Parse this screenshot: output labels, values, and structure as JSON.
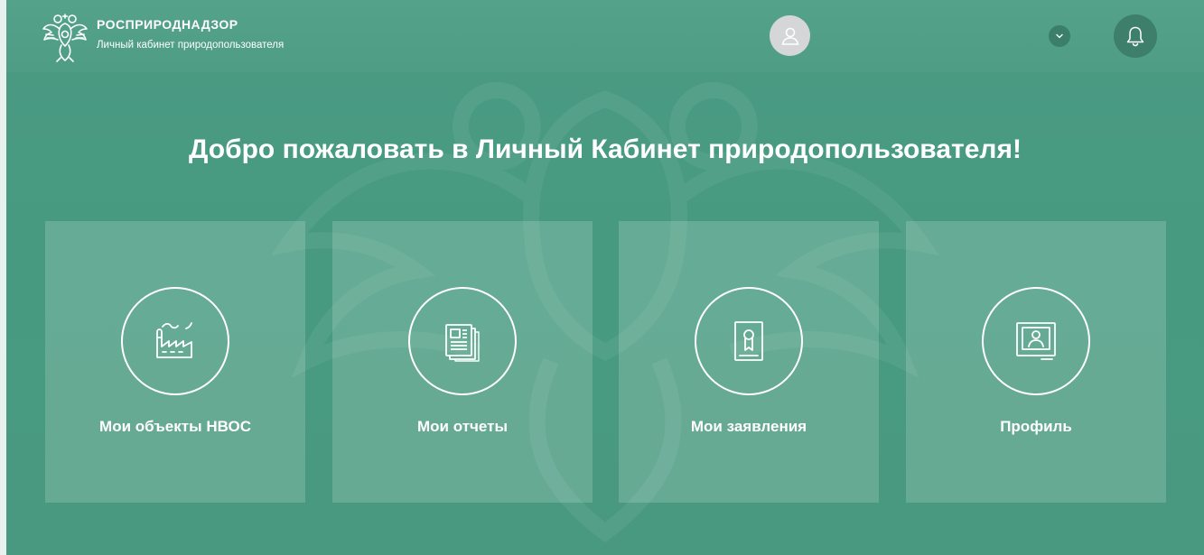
{
  "header": {
    "brand_title": "РОСПРИРОДНАДЗОР",
    "brand_subtitle": "Личный кабинет природопользователя",
    "logo_icon": "double-headed-eagle-emblem",
    "avatar_icon": "user-icon",
    "dropdown_icon": "chevron-down-icon",
    "notifications_icon": "bell-icon"
  },
  "main": {
    "welcome_title": "Добро пожаловать в Личный Кабинет природопользователя!",
    "cards": [
      {
        "label": "Мои объекты НВОС",
        "icon": "factory-icon"
      },
      {
        "label": "Мои отчеты",
        "icon": "documents-icon"
      },
      {
        "label": "Мои заявления",
        "icon": "certificate-icon"
      },
      {
        "label": "Профиль",
        "icon": "profile-card-icon"
      }
    ]
  },
  "colors": {
    "background": "#4a9a82",
    "accent_dark": "#3d7f6a",
    "text": "#ffffff",
    "avatar_bg": "#d4d6d8"
  }
}
